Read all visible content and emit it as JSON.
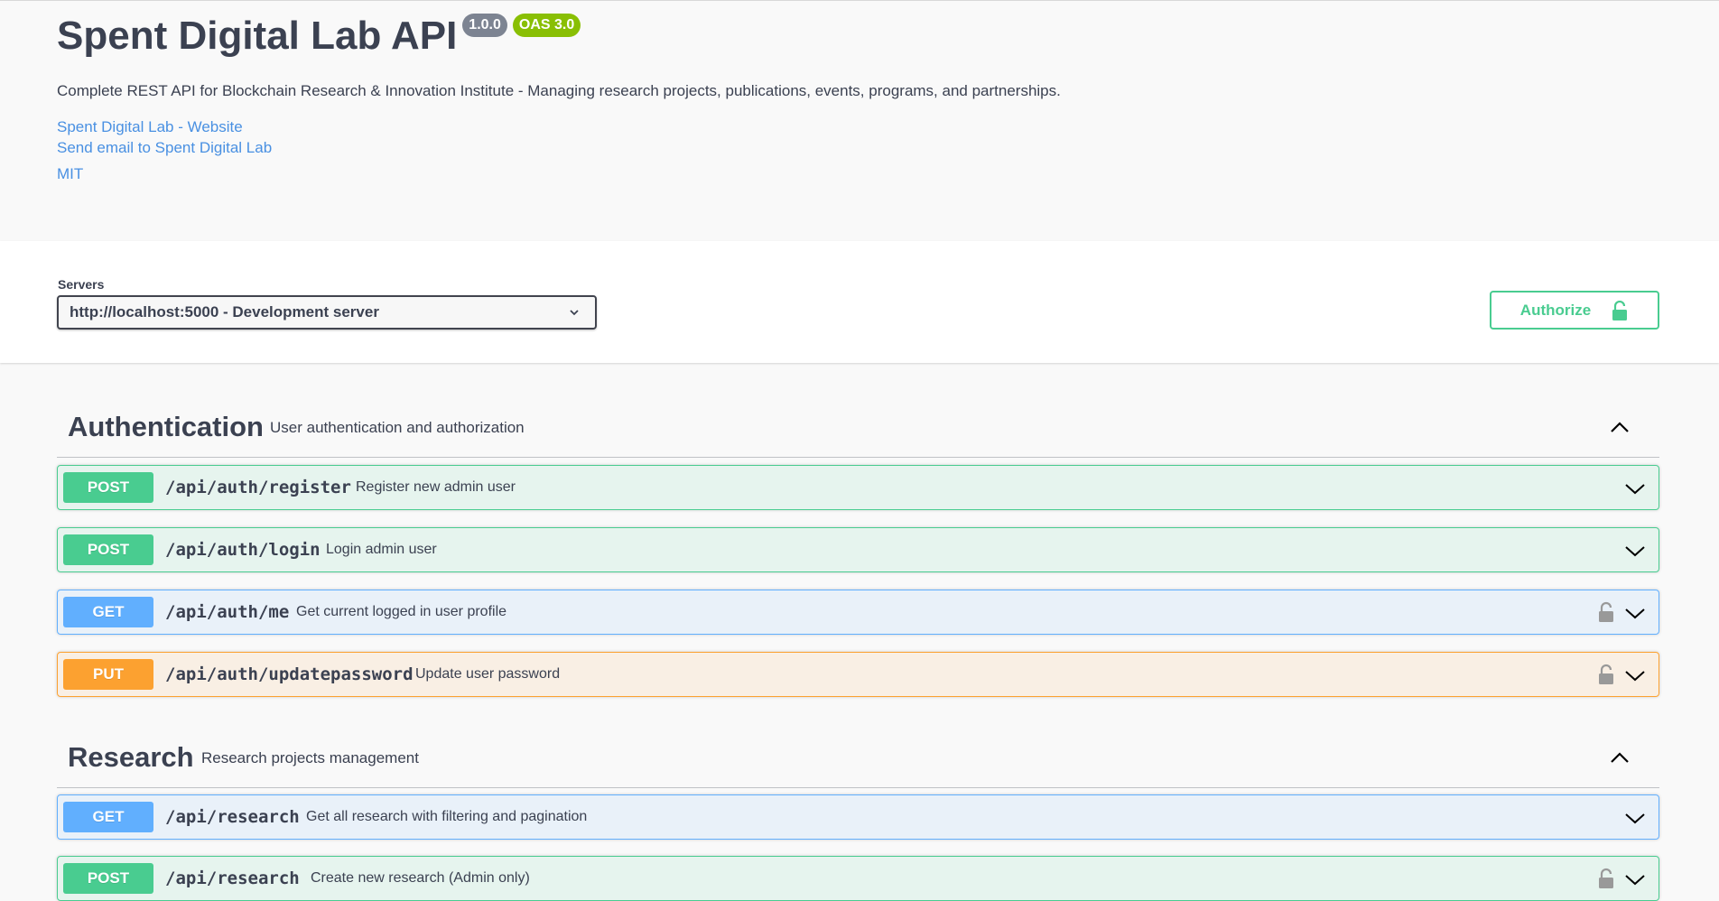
{
  "info": {
    "title": "Spent Digital Lab API",
    "version_badge": "1.0.0",
    "oas_badge": "OAS 3.0",
    "description": "Complete REST API for Blockchain Research & Innovation Institute - Managing research projects, publications, events, programs, and partnerships.",
    "website_link": "Spent Digital Lab - Website",
    "email_link": "Send email to Spent Digital Lab",
    "license_link": "MIT"
  },
  "servers": {
    "label": "Servers",
    "selected": "http://localhost:5000 - Development server"
  },
  "authorize": {
    "label": "Authorize",
    "icon": "unlocked-lock-icon"
  },
  "tags": [
    {
      "name": "Authentication",
      "description": "User authentication and authorization",
      "operations": [
        {
          "method": "POST",
          "path": "/api/auth/register",
          "summary": "Register new admin user",
          "locked": false
        },
        {
          "method": "POST",
          "path": "/api/auth/login",
          "summary": "Login admin user",
          "locked": false
        },
        {
          "method": "GET",
          "path": "/api/auth/me",
          "summary": "Get current logged in user profile",
          "locked": true
        },
        {
          "method": "PUT",
          "path": "/api/auth/updatepassword",
          "summary": "Update user password",
          "locked": true
        }
      ]
    },
    {
      "name": "Research",
      "description": "Research projects management",
      "operations": [
        {
          "method": "GET",
          "path": "/api/research",
          "summary": "Get all research with filtering and pagination",
          "locked": false
        },
        {
          "method": "POST",
          "path": "/api/research",
          "summary": "Create new research (Admin only)",
          "locked": true
        }
      ]
    }
  ],
  "colors": {
    "post": "#49cc90",
    "get": "#61affe",
    "put": "#fca130",
    "link": "#4990e2",
    "text": "#3b4151"
  }
}
